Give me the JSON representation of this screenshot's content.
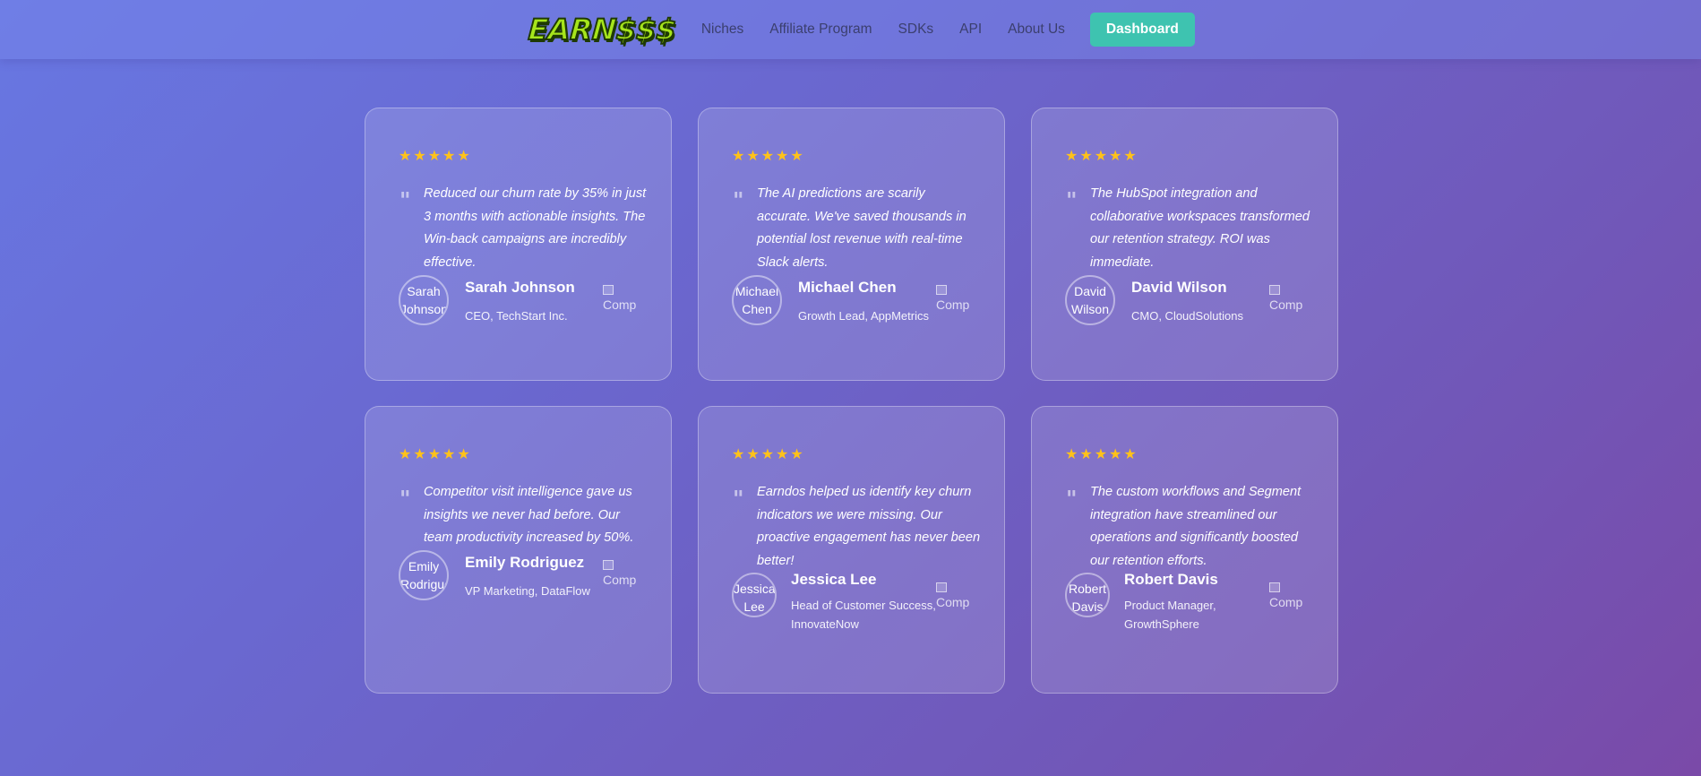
{
  "nav": {
    "logo": "EARN$$$",
    "links": [
      "Niches",
      "Affiliate Program",
      "SDKs",
      "API",
      "About Us"
    ],
    "cta": "Dashboard"
  },
  "testimonials": [
    {
      "stars": "★★★★★",
      "quote": "Reduced our churn rate by 35% in just 3 months with actionable insights. The Win-back campaigns are incredibly effective.",
      "name": "Sarah Johnson",
      "role": "CEO, TechStart Inc.",
      "avatar_alt": "Sarah Johnson",
      "company_alt": "Comp"
    },
    {
      "stars": "★★★★★",
      "quote": "The AI predictions are scarily accurate. We've saved thousands in potential lost revenue with real-time Slack alerts.",
      "name": "Michael Chen",
      "role": "Growth Lead, AppMetrics",
      "avatar_alt": "Michael Chen",
      "company_alt": "Comp"
    },
    {
      "stars": "★★★★★",
      "quote": "The HubSpot integration and collaborative workspaces transformed our retention strategy. ROI was immediate.",
      "name": "David Wilson",
      "role": "CMO, CloudSolutions",
      "avatar_alt": "David Wilson",
      "company_alt": "Comp"
    },
    {
      "stars": "★★★★★",
      "quote": "Competitor visit intelligence gave us insights we never had before. Our team productivity increased by 50%.",
      "name": "Emily Rodriguez",
      "role": "VP Marketing, DataFlow",
      "avatar_alt": "Emily Rodriguez",
      "company_alt": "Comp"
    },
    {
      "stars": "★★★★★",
      "quote": "Earndos helped us identify key churn indicators we were missing. Our proactive engagement has never been better!",
      "name": "Jessica Lee",
      "role": "Head of Customer Success, InnovateNow",
      "avatar_alt": "Jessica Lee",
      "company_alt": "Comp"
    },
    {
      "stars": "★★★★★",
      "quote": "The custom workflows and Segment integration have streamlined our operations and significantly boosted our retention efforts.",
      "name": "Robert Davis",
      "role": "Product Manager, GrowthSphere",
      "avatar_alt": "Robert Davis",
      "company_alt": "Comp"
    }
  ]
}
